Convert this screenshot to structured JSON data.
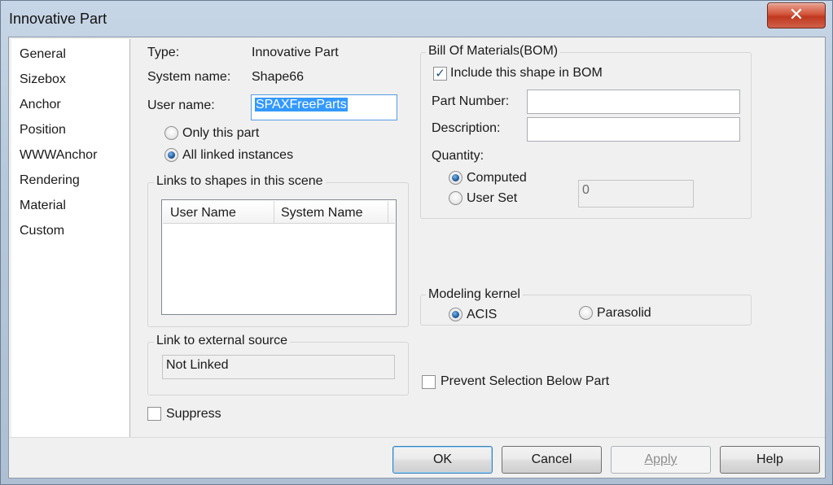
{
  "window": {
    "title": "Innovative Part"
  },
  "nav": {
    "items": [
      "General",
      "Sizebox",
      "Anchor",
      "Position",
      "WWWAnchor",
      "Rendering",
      "Material",
      "Custom"
    ]
  },
  "general": {
    "type_label": "Type:",
    "type_value": "Innovative Part",
    "system_name_label": "System name:",
    "system_name_value": "Shape66",
    "user_name_label": "User name:",
    "user_name_value": "SPAXFreeParts",
    "scope_options": [
      {
        "label": "Only this part",
        "checked": false
      },
      {
        "label": "All linked instances",
        "checked": true
      }
    ]
  },
  "links": {
    "group_title": "Links to shapes in this scene",
    "columns": [
      "User Name",
      "System Name"
    ],
    "rows": []
  },
  "external": {
    "group_title": "Link to external source",
    "value": "Not Linked"
  },
  "suppress": {
    "label": "Suppress",
    "checked": false
  },
  "bom": {
    "group_title": "Bill Of Materials(BOM)",
    "include_label": "Include this shape in BOM",
    "include_checked": true,
    "part_number_label": "Part Number:",
    "part_number_value": "",
    "description_label": "Description:",
    "description_value": "",
    "quantity_label": "Quantity:",
    "quantity_options": [
      {
        "label": "Computed",
        "checked": true
      },
      {
        "label": "User Set",
        "checked": false
      }
    ],
    "quantity_value": "0"
  },
  "kernel": {
    "group_title": "Modeling kernel",
    "options": [
      {
        "label": "ACIS",
        "checked": true
      },
      {
        "label": "Parasolid",
        "checked": false
      }
    ]
  },
  "prevent_selection": {
    "label": "Prevent Selection Below Part",
    "checked": false
  },
  "buttons": {
    "ok": "OK",
    "cancel": "Cancel",
    "apply": "Apply",
    "help": "Help"
  },
  "icons": {
    "close": "close-icon",
    "checkmark": "checkmark-icon"
  },
  "colors": {
    "selection": "#3399ff",
    "close_button": "#c7402a"
  }
}
